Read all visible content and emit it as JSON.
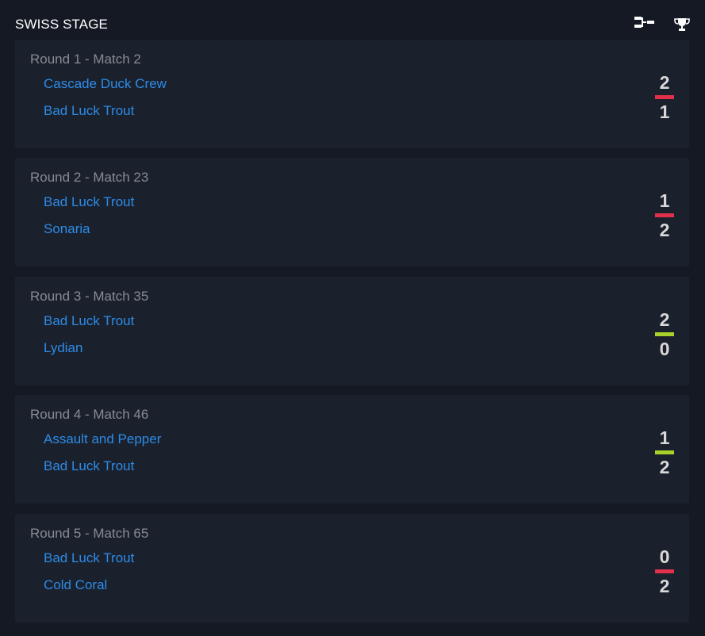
{
  "header": {
    "title": "SWISS STAGE",
    "bracket_icon": "bracket-icon",
    "trophy_icon": "trophy-icon"
  },
  "colors": {
    "loss": "#e0304a",
    "win": "#a8d12a",
    "team_link": "#2c8be8"
  },
  "matches": [
    {
      "label": "Round 1 - Match 2",
      "team1": "Cascade Duck Crew",
      "team2": "Bad Luck Trout",
      "score1": "2",
      "score2": "1",
      "result": "loss"
    },
    {
      "label": "Round 2 - Match 23",
      "team1": "Bad Luck Trout",
      "team2": "Sonaria",
      "score1": "1",
      "score2": "2",
      "result": "loss"
    },
    {
      "label": "Round 3 - Match 35",
      "team1": "Bad Luck Trout",
      "team2": "Lydian",
      "score1": "2",
      "score2": "0",
      "result": "win"
    },
    {
      "label": "Round 4 - Match 46",
      "team1": "Assault and Pepper",
      "team2": "Bad Luck Trout",
      "score1": "1",
      "score2": "2",
      "result": "win"
    },
    {
      "label": "Round 5 - Match 65",
      "team1": "Bad Luck Trout",
      "team2": "Cold Coral",
      "score1": "0",
      "score2": "2",
      "result": "loss"
    }
  ]
}
